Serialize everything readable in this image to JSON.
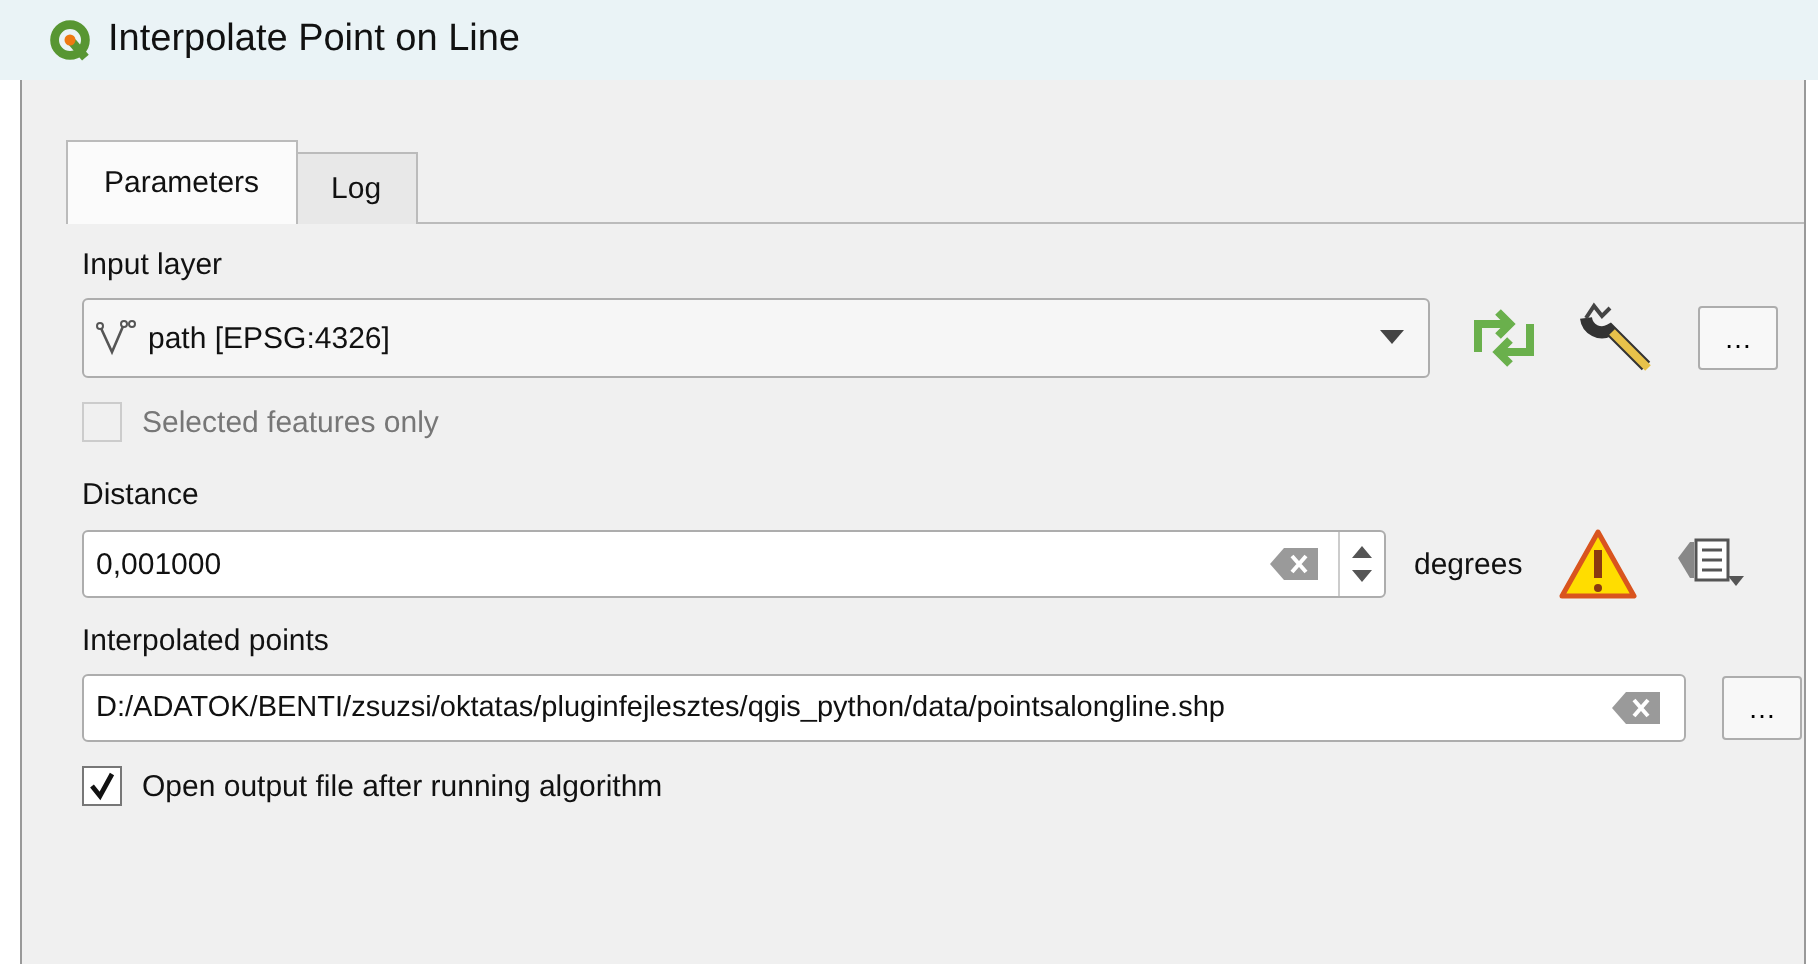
{
  "window": {
    "title": "Interpolate Point on Line"
  },
  "tabs": [
    {
      "label": "Parameters",
      "selected": true
    },
    {
      "label": "Log",
      "selected": false
    }
  ],
  "input_layer": {
    "label": "Input layer",
    "value": "path [EPSG:4326]",
    "more_button": "…"
  },
  "selected_only": {
    "label": "Selected features only",
    "checked": false,
    "disabled": true
  },
  "distance": {
    "label": "Distance",
    "value": "0,001000",
    "unit": "degrees"
  },
  "output": {
    "label": "Interpolated points",
    "value": "D:/ADATOK/BENTI/zsuzsi/oktatas/pluginfejlesztes/qgis_python/data/pointsalongline.shp",
    "more_button": "…"
  },
  "open_output": {
    "label": "Open output file after running algorithm",
    "checked": true,
    "disabled": false
  }
}
